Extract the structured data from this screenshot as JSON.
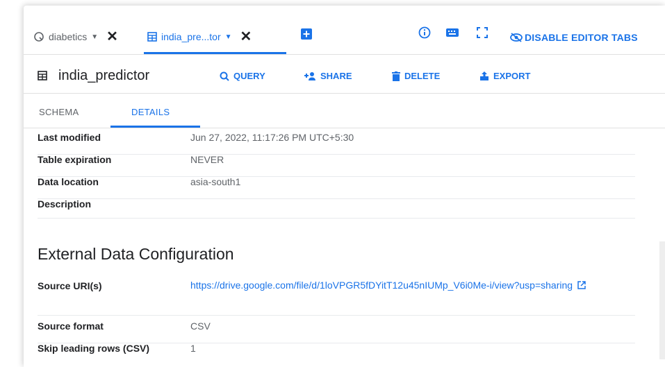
{
  "tabs": [
    {
      "label": "diabetics",
      "icon": "query-icon"
    },
    {
      "label": "india_pre...tor",
      "icon": "table-icon"
    }
  ],
  "toolbar": {
    "disable_label": "DISABLE EDITOR TABS"
  },
  "header": {
    "title": "india_predictor",
    "actions": {
      "query": "QUERY",
      "share": "SHARE",
      "delete": "DELETE",
      "export": "EXPORT"
    }
  },
  "subtabs": {
    "schema": "SCHEMA",
    "details": "DETAILS"
  },
  "details": {
    "last_modified": {
      "key": "Last modified",
      "value": "Jun 27, 2022, 11:17:26 PM UTC+5:30"
    },
    "table_expiration": {
      "key": "Table expiration",
      "value": "NEVER"
    },
    "data_location": {
      "key": "Data location",
      "value": "asia-south1"
    },
    "description": {
      "key": "Description",
      "value": ""
    }
  },
  "external": {
    "title": "External Data Configuration",
    "source_uri": {
      "key": "Source URI(s)",
      "value": "https://drive.google.com/file/d/1loVPGR5fDYitT12u45nIUMp_V6i0Me-i/view?usp=sharing"
    },
    "source_format": {
      "key": "Source format",
      "value": "CSV"
    },
    "skip_rows": {
      "key": "Skip leading rows (CSV)",
      "value": "1"
    }
  },
  "colors": {
    "accent": "#1a73e8",
    "text": "#202124",
    "muted": "#5f6368"
  }
}
